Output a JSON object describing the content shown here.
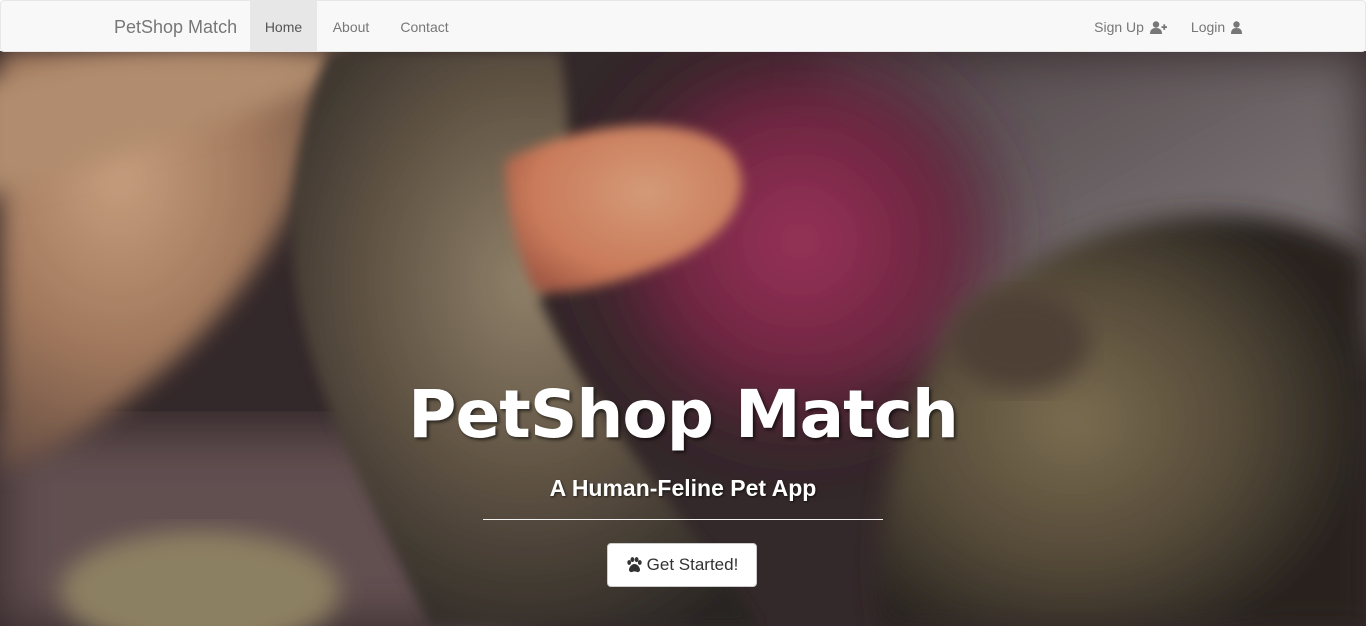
{
  "navbar": {
    "brand": "PetShop Match",
    "items": [
      {
        "label": "Home",
        "active": true
      },
      {
        "label": "About",
        "active": false
      },
      {
        "label": "Contact",
        "active": false
      }
    ],
    "right_items": [
      {
        "label": "Sign Up",
        "icon": "user-plus-icon"
      },
      {
        "label": "Login",
        "icon": "user-icon"
      }
    ]
  },
  "hero": {
    "title": "PetShop Match",
    "subtitle": "A Human-Feline Pet App",
    "cta_label": "Get Started!",
    "cta_icon": "paw-icon"
  },
  "colors": {
    "navbar_bg": "#f8f8f8",
    "nav_text": "#777777",
    "nav_active_bg": "#e7e7e7",
    "hero_text": "#ffffff"
  }
}
